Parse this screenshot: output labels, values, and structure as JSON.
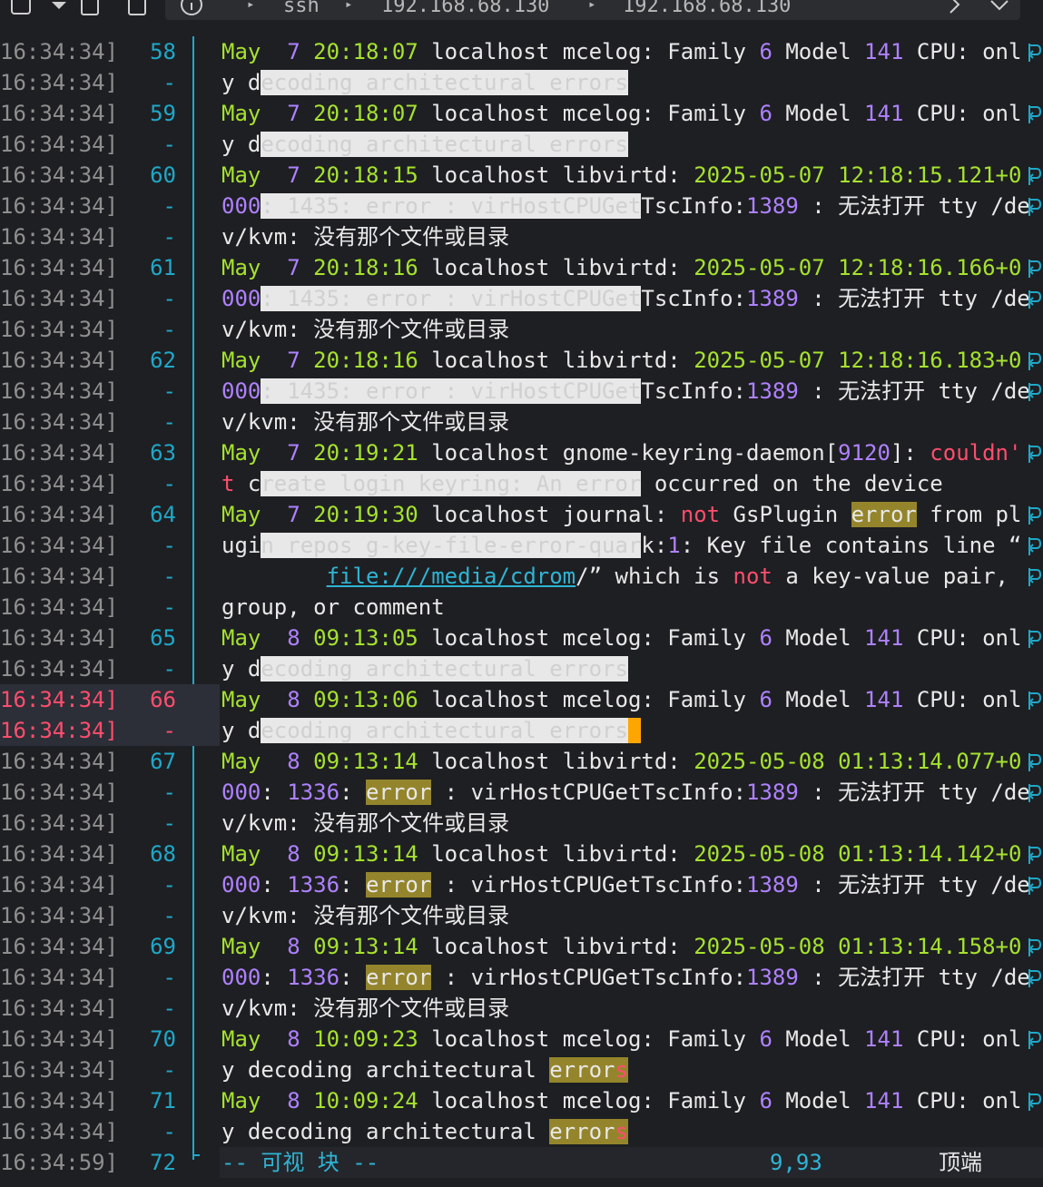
{
  "toolbar": {
    "icons": [
      "sidebar-icon",
      "dropdown-icon",
      "file-icon",
      "file-icon",
      "info-icon"
    ],
    "crumbs": [
      "ssh",
      "192.168.68.130",
      "192.168.68.130"
    ]
  },
  "rows": [
    {
      "ts": "16:34:34]",
      "ln": "58",
      "segs": [
        [
          "May ",
          "g"
        ],
        [
          " 7 ",
          "p"
        ],
        [
          "20:18:07",
          "g"
        ],
        [
          " localhost mcelog",
          ""
        ],
        [
          ":",
          ""
        ],
        [
          " Family ",
          ""
        ],
        [
          "6",
          "p"
        ],
        [
          " Model ",
          ""
        ],
        [
          "141",
          "p"
        ],
        [
          " CPU",
          ""
        ],
        [
          ": onl",
          ""
        ]
      ],
      "wrap": true
    },
    {
      "ts": "16:34:34]",
      "ln": "-",
      "segs": [
        [
          "y d",
          ""
        ],
        [
          "ecoding architectural errors",
          "vis"
        ]
      ]
    },
    {
      "ts": "16:34:34]",
      "ln": "59",
      "segs": [
        [
          "May ",
          "g"
        ],
        [
          " 7 ",
          "p"
        ],
        [
          "20:18:07",
          "g"
        ],
        [
          " localhost mcelog",
          ""
        ],
        [
          ":",
          ""
        ],
        [
          " Family ",
          ""
        ],
        [
          "6",
          "p"
        ],
        [
          " Model ",
          ""
        ],
        [
          "141",
          "p"
        ],
        [
          " CPU",
          ""
        ],
        [
          ": onl",
          ""
        ]
      ],
      "wrap": true
    },
    {
      "ts": "16:34:34]",
      "ln": "-",
      "segs": [
        [
          "y d",
          ""
        ],
        [
          "ecoding architectural errors",
          "vis"
        ]
      ]
    },
    {
      "ts": "16:34:34]",
      "ln": "60",
      "segs": [
        [
          "May ",
          "g"
        ],
        [
          " 7 ",
          "p"
        ],
        [
          "20:18:15",
          "g"
        ],
        [
          " localhost libvirtd",
          ""
        ],
        [
          ": ",
          ""
        ],
        [
          "2025-05-07",
          "g"
        ],
        [
          " ",
          ""
        ],
        [
          "12:18:15.121+0",
          "g"
        ]
      ],
      "wrap": true
    },
    {
      "ts": "16:34:34]",
      "ln": "-",
      "segs": [
        [
          "000",
          "p"
        ],
        [
          ": 1435: error : virHostCPUGet",
          "vis"
        ],
        [
          "TscInfo",
          ""
        ],
        [
          ":",
          ""
        ],
        [
          "1389",
          "p"
        ],
        [
          " : 无法打开 tty /de",
          ""
        ]
      ],
      "wrap": true
    },
    {
      "ts": "16:34:34]",
      "ln": "-",
      "segs": [
        [
          "v/kvm",
          ""
        ],
        [
          ": 没有那个文件或目录",
          ""
        ]
      ]
    },
    {
      "ts": "16:34:34]",
      "ln": "61",
      "segs": [
        [
          "May ",
          "g"
        ],
        [
          " 7 ",
          "p"
        ],
        [
          "20:18:16",
          "g"
        ],
        [
          " localhost libvirtd",
          ""
        ],
        [
          ": ",
          ""
        ],
        [
          "2025-05-07",
          "g"
        ],
        [
          " ",
          ""
        ],
        [
          "12:18:16.166+0",
          "g"
        ]
      ],
      "wrap": true
    },
    {
      "ts": "16:34:34]",
      "ln": "-",
      "segs": [
        [
          "000",
          "p"
        ],
        [
          ": 1435: error : virHostCPUGet",
          "vis"
        ],
        [
          "TscInfo",
          ""
        ],
        [
          ":",
          ""
        ],
        [
          "1389",
          "p"
        ],
        [
          " : 无法打开 tty /de",
          ""
        ]
      ],
      "wrap": true
    },
    {
      "ts": "16:34:34]",
      "ln": "-",
      "segs": [
        [
          "v/kvm",
          ""
        ],
        [
          ": 没有那个文件或目录",
          ""
        ]
      ]
    },
    {
      "ts": "16:34:34]",
      "ln": "62",
      "segs": [
        [
          "May ",
          "g"
        ],
        [
          " 7 ",
          "p"
        ],
        [
          "20:18:16",
          "g"
        ],
        [
          " localhost libvirtd",
          ""
        ],
        [
          ": ",
          ""
        ],
        [
          "2025-05-07",
          "g"
        ],
        [
          " ",
          ""
        ],
        [
          "12:18:16.183+0",
          "g"
        ]
      ],
      "wrap": true
    },
    {
      "ts": "16:34:34]",
      "ln": "-",
      "segs": [
        [
          "000",
          "p"
        ],
        [
          ": 1435: error : virHostCPUGet",
          "vis"
        ],
        [
          "TscInfo",
          ""
        ],
        [
          ":",
          ""
        ],
        [
          "1389",
          "p"
        ],
        [
          " : 无法打开 tty /de",
          ""
        ]
      ],
      "wrap": true
    },
    {
      "ts": "16:34:34]",
      "ln": "-",
      "segs": [
        [
          "v/kvm",
          ""
        ],
        [
          ": 没有那个文件或目录",
          ""
        ]
      ]
    },
    {
      "ts": "16:34:34]",
      "ln": "63",
      "segs": [
        [
          "May ",
          "g"
        ],
        [
          " 7 ",
          "p"
        ],
        [
          "20:19:21",
          "g"
        ],
        [
          " localhost gnome-keyring-daemon",
          ""
        ],
        [
          "[",
          ""
        ],
        [
          "9120",
          "p"
        ],
        [
          "]: ",
          ""
        ],
        [
          "couldn'",
          "r"
        ]
      ],
      "wrap": true
    },
    {
      "ts": "16:34:34]",
      "ln": "-",
      "segs": [
        [
          "t",
          "r"
        ],
        [
          " c",
          ""
        ],
        [
          "reate login keyring: An error",
          "vis"
        ],
        [
          " occurred on the device",
          ""
        ]
      ]
    },
    {
      "ts": "16:34:34]",
      "ln": "64",
      "segs": [
        [
          "May ",
          "g"
        ],
        [
          " 7 ",
          "p"
        ],
        [
          "20:19:30",
          "g"
        ],
        [
          " localhost journal",
          ""
        ],
        [
          ": ",
          ""
        ],
        [
          "not",
          "r"
        ],
        [
          " GsPlugin ",
          ""
        ],
        [
          "error",
          "hl"
        ],
        [
          " from pl",
          ""
        ]
      ],
      "wrap": true
    },
    {
      "ts": "16:34:34]",
      "ln": "-",
      "segs": [
        [
          "ugi",
          ""
        ],
        [
          "n repos g-key-file-error-quar",
          "vis"
        ],
        [
          "k",
          ""
        ],
        [
          ":",
          ""
        ],
        [
          "1",
          "p"
        ],
        [
          ": Key file contains line “ ",
          ""
        ]
      ],
      "wrap": true
    },
    {
      "ts": "16:34:34]",
      "ln": "-",
      "segs": [
        [
          "        ",
          ""
        ],
        [
          "file:///media/cdrom",
          "link"
        ],
        [
          "/” which is ",
          ""
        ],
        [
          "not",
          "r"
        ],
        [
          " a key-value pair, ",
          ""
        ]
      ],
      "wrap": true
    },
    {
      "ts": "16:34:34]",
      "ln": "-",
      "segs": [
        [
          "group, or comment",
          ""
        ]
      ]
    },
    {
      "ts": "16:34:34]",
      "ln": "65",
      "segs": [
        [
          "May ",
          "g"
        ],
        [
          " 8 ",
          "p"
        ],
        [
          "09:13:05",
          "g"
        ],
        [
          " localhost mcelog",
          ""
        ],
        [
          ":",
          ""
        ],
        [
          " Family ",
          ""
        ],
        [
          "6",
          "p"
        ],
        [
          " Model ",
          ""
        ],
        [
          "141",
          "p"
        ],
        [
          " CPU",
          ""
        ],
        [
          ": onl",
          ""
        ]
      ],
      "wrap": true
    },
    {
      "ts": "16:34:34]",
      "ln": "-",
      "segs": [
        [
          "y d",
          ""
        ],
        [
          "ecoding architectural errors",
          "vis"
        ]
      ]
    },
    {
      "ts": "16:34:34]",
      "ln": "66",
      "current": true,
      "segs": [
        [
          "May ",
          "g"
        ],
        [
          " 8 ",
          "p"
        ],
        [
          "09:13:06",
          "g"
        ],
        [
          " localhost mcelog",
          ""
        ],
        [
          ":",
          ""
        ],
        [
          " Family ",
          ""
        ],
        [
          "6",
          "p"
        ],
        [
          " Model ",
          ""
        ],
        [
          "141",
          "p"
        ],
        [
          " CPU",
          ""
        ],
        [
          ": onl",
          ""
        ]
      ],
      "wrap": true
    },
    {
      "ts": "16:34:34]",
      "ln": "-",
      "current": true,
      "segs": [
        [
          "y d",
          ""
        ],
        [
          "ecoding architectural errors",
          "vis"
        ],
        [
          "_",
          "cursor"
        ]
      ]
    },
    {
      "ts": "16:34:34]",
      "ln": "67",
      "segs": [
        [
          "May ",
          "g"
        ],
        [
          " 8 ",
          "p"
        ],
        [
          "09:13:14",
          "g"
        ],
        [
          " localhost libvirtd",
          ""
        ],
        [
          ": ",
          ""
        ],
        [
          "2025-05-08",
          "g"
        ],
        [
          " ",
          ""
        ],
        [
          "01:13:14.077+0",
          "g"
        ]
      ],
      "wrap": true
    },
    {
      "ts": "16:34:34]",
      "ln": "-",
      "segs": [
        [
          "000",
          "p"
        ],
        [
          ": ",
          ""
        ],
        [
          "1336",
          "p"
        ],
        [
          ": ",
          ""
        ],
        [
          "error",
          "hl"
        ],
        [
          " : virHostCPUGetTscInfo",
          ""
        ],
        [
          ":",
          ""
        ],
        [
          "1389",
          "p"
        ],
        [
          " : 无法打开 tty /de",
          ""
        ]
      ],
      "wrap": true
    },
    {
      "ts": "16:34:34]",
      "ln": "-",
      "segs": [
        [
          "v/kvm",
          ""
        ],
        [
          ": 没有那个文件或目录",
          ""
        ]
      ]
    },
    {
      "ts": "16:34:34]",
      "ln": "68",
      "segs": [
        [
          "May ",
          "g"
        ],
        [
          " 8 ",
          "p"
        ],
        [
          "09:13:14",
          "g"
        ],
        [
          " localhost libvirtd",
          ""
        ],
        [
          ": ",
          ""
        ],
        [
          "2025-05-08",
          "g"
        ],
        [
          " ",
          ""
        ],
        [
          "01:13:14.142+0",
          "g"
        ]
      ],
      "wrap": true
    },
    {
      "ts": "16:34:34]",
      "ln": "-",
      "segs": [
        [
          "000",
          "p"
        ],
        [
          ": ",
          ""
        ],
        [
          "1336",
          "p"
        ],
        [
          ": ",
          ""
        ],
        [
          "error",
          "hl"
        ],
        [
          " : virHostCPUGetTscInfo",
          ""
        ],
        [
          ":",
          ""
        ],
        [
          "1389",
          "p"
        ],
        [
          " : 无法打开 tty /de",
          ""
        ]
      ],
      "wrap": true
    },
    {
      "ts": "16:34:34]",
      "ln": "-",
      "segs": [
        [
          "v/kvm",
          ""
        ],
        [
          ": 没有那个文件或目录",
          ""
        ]
      ]
    },
    {
      "ts": "16:34:34]",
      "ln": "69",
      "segs": [
        [
          "May ",
          "g"
        ],
        [
          " 8 ",
          "p"
        ],
        [
          "09:13:14",
          "g"
        ],
        [
          " localhost libvirtd",
          ""
        ],
        [
          ": ",
          ""
        ],
        [
          "2025-05-08",
          "g"
        ],
        [
          " ",
          ""
        ],
        [
          "01:13:14.158+0",
          "g"
        ]
      ],
      "wrap": true
    },
    {
      "ts": "16:34:34]",
      "ln": "-",
      "segs": [
        [
          "000",
          "p"
        ],
        [
          ": ",
          ""
        ],
        [
          "1336",
          "p"
        ],
        [
          ": ",
          ""
        ],
        [
          "error",
          "hl"
        ],
        [
          " : virHostCPUGetTscInfo",
          ""
        ],
        [
          ":",
          ""
        ],
        [
          "1389",
          "p"
        ],
        [
          " : 无法打开 tty /de",
          ""
        ]
      ],
      "wrap": true
    },
    {
      "ts": "16:34:34]",
      "ln": "-",
      "segs": [
        [
          "v/kvm",
          ""
        ],
        [
          ": 没有那个文件或目录",
          ""
        ]
      ]
    },
    {
      "ts": "16:34:34]",
      "ln": "70",
      "segs": [
        [
          "May ",
          "g"
        ],
        [
          " 8 ",
          "p"
        ],
        [
          "10:09:23",
          "g"
        ],
        [
          " localhost mcelog",
          ""
        ],
        [
          ":",
          ""
        ],
        [
          " Family ",
          ""
        ],
        [
          "6",
          "p"
        ],
        [
          " Model ",
          ""
        ],
        [
          "141",
          "p"
        ],
        [
          " CPU",
          ""
        ],
        [
          ": onl",
          ""
        ]
      ],
      "wrap": true
    },
    {
      "ts": "16:34:34]",
      "ln": "-",
      "segs": [
        [
          "y decoding architectural ",
          ""
        ],
        [
          "error",
          "hl"
        ],
        [
          "s",
          "hlr"
        ]
      ]
    },
    {
      "ts": "16:34:34]",
      "ln": "71",
      "segs": [
        [
          "May ",
          "g"
        ],
        [
          " 8 ",
          "p"
        ],
        [
          "10:09:24",
          "g"
        ],
        [
          " localhost mcelog",
          ""
        ],
        [
          ":",
          ""
        ],
        [
          " Family ",
          ""
        ],
        [
          "6",
          "p"
        ],
        [
          " Model ",
          ""
        ],
        [
          "141",
          "p"
        ],
        [
          " CPU",
          ""
        ],
        [
          ": onl",
          ""
        ]
      ],
      "wrap": true
    },
    {
      "ts": "16:34:34]",
      "ln": "-",
      "segs": [
        [
          "y decoding architectural ",
          ""
        ],
        [
          "error",
          "hl"
        ],
        [
          "s",
          "hlr"
        ]
      ]
    }
  ],
  "status": {
    "ts": "16:34:59]",
    "ln": "72",
    "mode": "-- 可视 块 --",
    "pos": "9,93",
    "scroll": "顶端"
  }
}
